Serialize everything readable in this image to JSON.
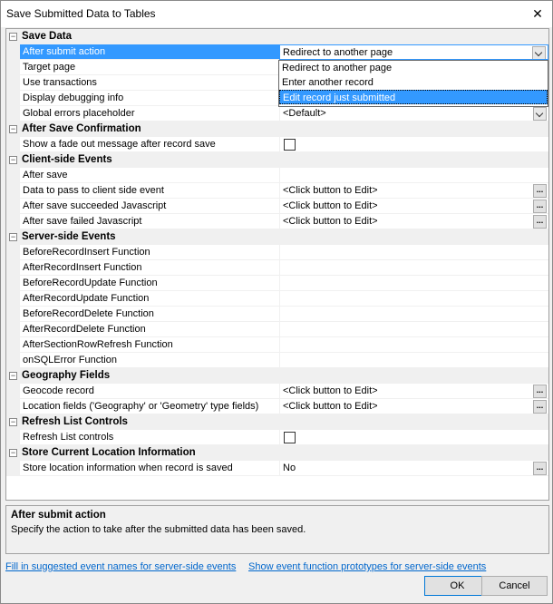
{
  "window": {
    "title": "Save Submitted Data to Tables",
    "close_glyph": "✕"
  },
  "categories": {
    "save_data": "Save Data",
    "after_save_confirmation": "After Save Confirmation",
    "client_side_events": "Client-side Events",
    "server_side_events": "Server-side Events",
    "geography_fields": "Geography Fields",
    "refresh_list_controls": "Refresh List Controls",
    "store_current_location": "Store Current Location Information"
  },
  "toggle_glyph": "−",
  "ellipsis": "...",
  "properties": {
    "after_submit_action": {
      "name": "After submit action",
      "value": "Redirect to another page"
    },
    "target_page": {
      "name": "Target page"
    },
    "use_transactions": {
      "name": "Use transactions"
    },
    "display_debugging_info": {
      "name": "Display debugging info"
    },
    "global_errors_placeholder": {
      "name": "Global errors placeholder",
      "value": "<Default>"
    },
    "show_fade_out": {
      "name": "Show a fade out message after record save",
      "checked": false
    },
    "after_save": {
      "name": "After save"
    },
    "data_to_pass": {
      "name": "Data to pass to client side event",
      "value": "<Click button to Edit>"
    },
    "after_save_succeeded_js": {
      "name": "After save succeeded Javascript",
      "value": "<Click button to Edit>"
    },
    "after_save_failed_js": {
      "name": "After save failed Javascript",
      "value": "<Click button to Edit>"
    },
    "before_record_insert": {
      "name": "BeforeRecordInsert Function"
    },
    "after_record_insert": {
      "name": "AfterRecordInsert Function"
    },
    "before_record_update": {
      "name": "BeforeRecordUpdate Function"
    },
    "after_record_update": {
      "name": "AfterRecordUpdate Function"
    },
    "before_record_delete": {
      "name": "BeforeRecordDelete Function"
    },
    "after_record_delete": {
      "name": "AfterRecordDelete Function"
    },
    "after_section_row_refresh": {
      "name": "AfterSectionRowRefresh Function"
    },
    "on_sql_error": {
      "name": "onSQLError Function"
    },
    "geocode_record": {
      "name": "Geocode record",
      "value": "<Click button to Edit>"
    },
    "location_fields": {
      "name": "Location fields ('Geography' or 'Geometry' type fields)",
      "value": "<Click button to Edit>"
    },
    "refresh_list_controls": {
      "name": "Refresh List controls",
      "checked": false
    },
    "store_location": {
      "name": "Store location information when record is saved",
      "value": "No"
    }
  },
  "dropdown": {
    "options": [
      "Redirect to another page",
      "Enter another record",
      "Edit record just submitted"
    ],
    "highlighted_index": 2
  },
  "description": {
    "title": "After submit action",
    "text": "Specify the action to take after the submitted data has been saved."
  },
  "links": {
    "fill_in": "Fill in suggested event names for server-side events",
    "show_prototypes": "Show event function prototypes for server-side events"
  },
  "buttons": {
    "ok": "OK",
    "cancel": "Cancel"
  },
  "colors": {
    "selection": "#3399ff",
    "link": "#0066cc"
  }
}
